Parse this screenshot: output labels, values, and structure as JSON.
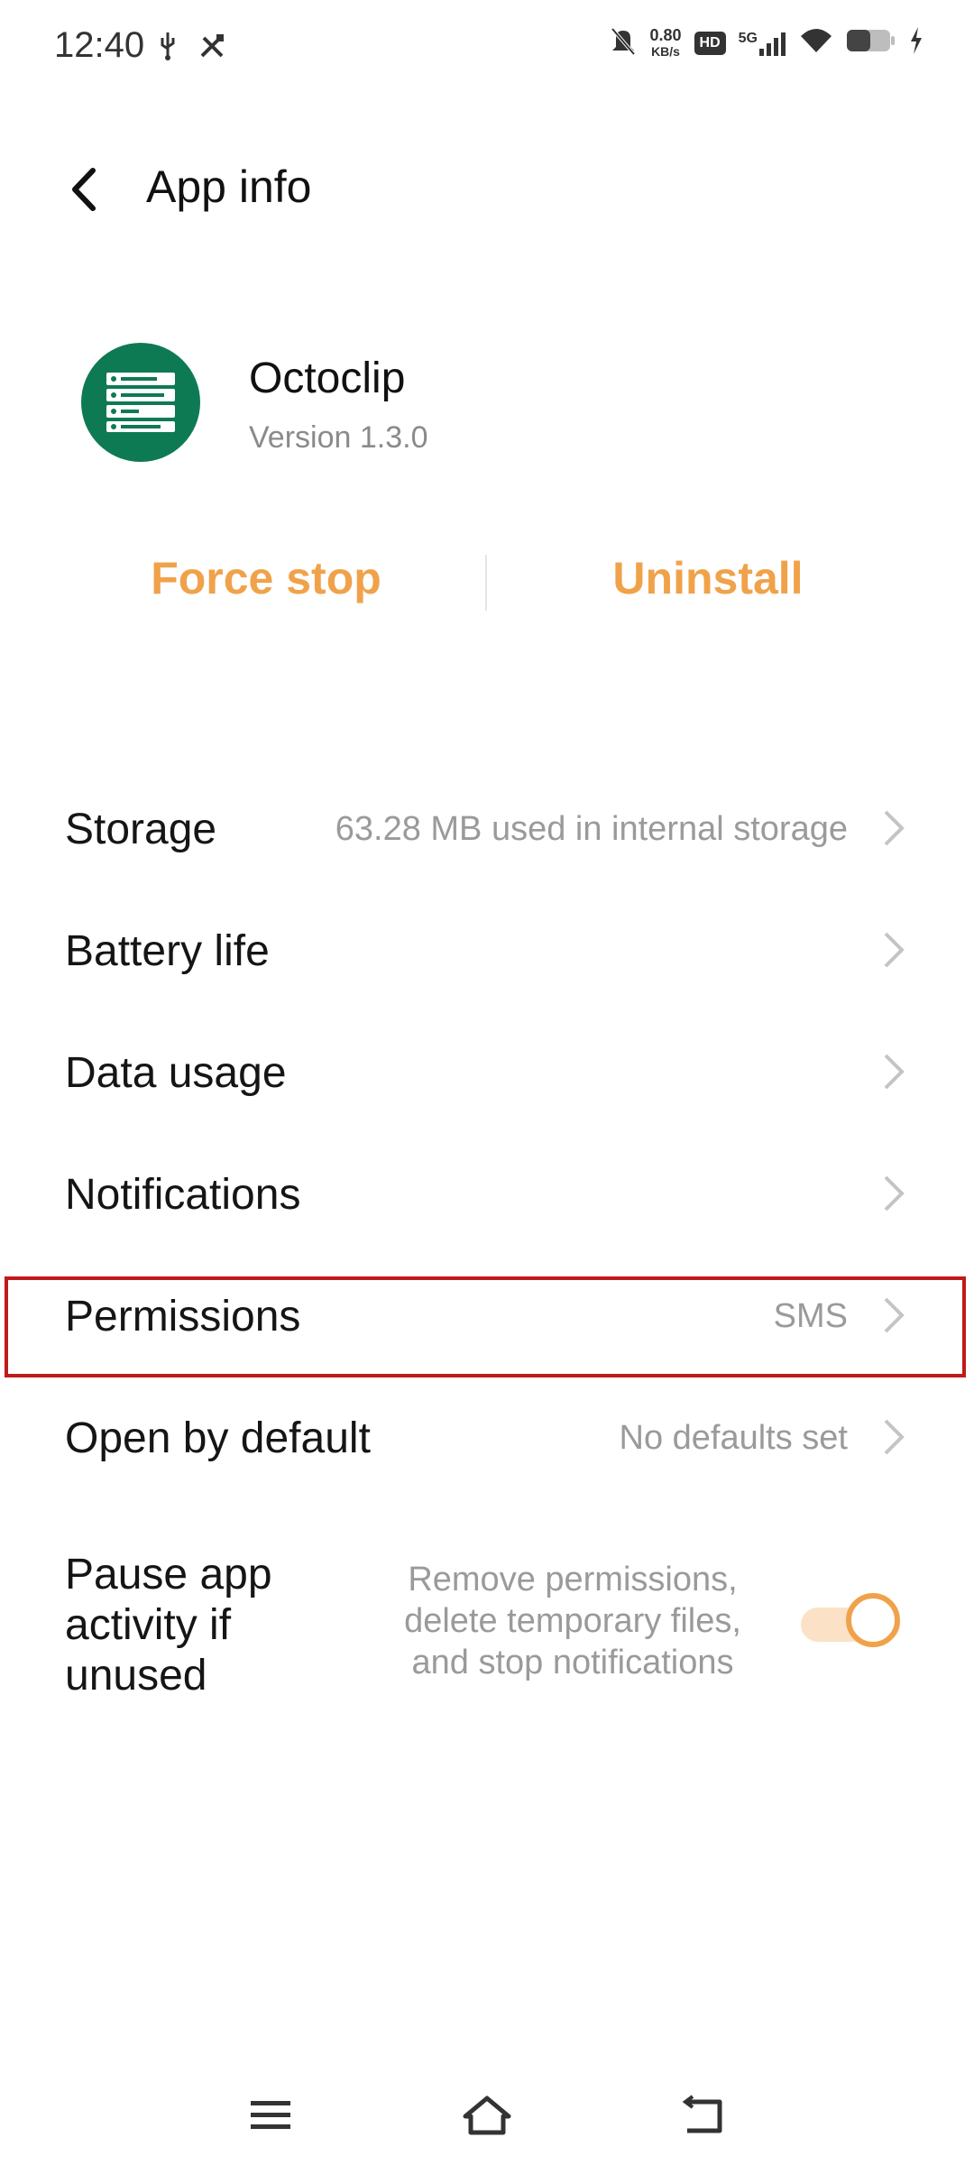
{
  "status_bar": {
    "time": "12:40",
    "speed_value": "0.80",
    "speed_unit": "KB/s",
    "hd_badge": "HD",
    "network": "5G",
    "icons": [
      "usb-icon",
      "tools-icon",
      "mute-icon",
      "signal-icon",
      "wifi-icon",
      "battery-icon",
      "charging-icon"
    ]
  },
  "header": {
    "title": "App info"
  },
  "app": {
    "name": "Octoclip",
    "version": "Version 1.3.0",
    "icon_color": "#0e7a54"
  },
  "actions": {
    "force_stop": "Force stop",
    "uninstall": "Uninstall",
    "accent_color": "#f0a24a"
  },
  "rows": [
    {
      "label": "Storage",
      "value": "63.28 MB used in internal storage"
    },
    {
      "label": "Battery life",
      "value": ""
    },
    {
      "label": "Data usage",
      "value": ""
    },
    {
      "label": "Notifications",
      "value": ""
    },
    {
      "label": "Permissions",
      "value": "SMS"
    },
    {
      "label": "Open by default",
      "value": "No defaults set"
    }
  ],
  "pause": {
    "label": "Pause app activity if unused",
    "description": "Remove permissions, delete temporary files, and stop notifications",
    "toggle_on": true
  },
  "nav": {
    "icons": [
      "menu-icon",
      "home-icon",
      "back-icon"
    ]
  }
}
